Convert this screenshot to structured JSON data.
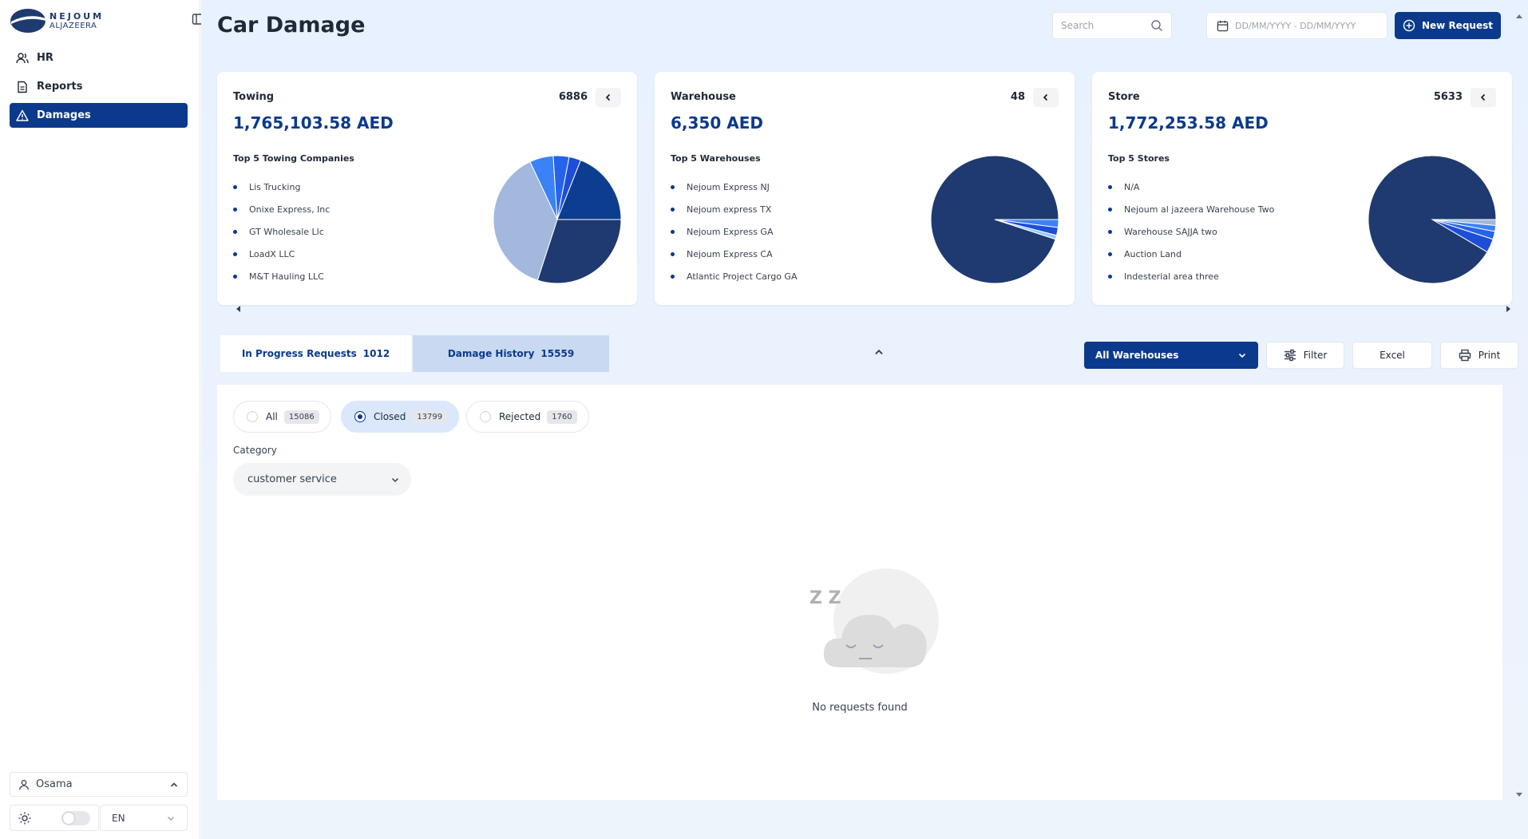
{
  "brand": {
    "line1": "NEJOUM",
    "line2": "ALJAZEERA",
    "logo_icon": "nejoum-logo-icon"
  },
  "sidebar": {
    "collapse_icon": "sidebar-toggle-icon",
    "items": [
      {
        "label": "HR",
        "icon": "users-icon",
        "active": false
      },
      {
        "label": "Reports",
        "icon": "report-icon",
        "active": false
      },
      {
        "label": "Damages",
        "icon": "warning-icon",
        "active": true
      }
    ],
    "user": {
      "name": "Osama",
      "icon": "user-icon"
    },
    "theme": {
      "icon": "sun-icon",
      "dark_mode": false
    },
    "language": {
      "value": "EN"
    }
  },
  "header": {
    "title": "Car Damage",
    "search_placeholder": "Search",
    "date_placeholder": "DD/MM/YYYY - DD/MM/YYYY",
    "new_request_label": "New Request"
  },
  "cards": [
    {
      "title": "Towing",
      "count": "6886",
      "amount": "1,765,103.58 AED",
      "subtitle": "Top 5 Towing Companies",
      "items": [
        "Lis Trucking",
        "Onixe Express, Inc",
        "GT Wholesale Llc",
        "LoadX LLC",
        "M&T Hauling LLC"
      ]
    },
    {
      "title": "Warehouse",
      "count": "48",
      "amount": "6,350 AED",
      "subtitle": "Top 5 Warehouses",
      "items": [
        "Nejoum Express NJ",
        "Nejoum express TX",
        "Nejoum Express GA",
        "Nejoum Express CA",
        "Atlantic Project Cargo GA"
      ]
    },
    {
      "title": "Store",
      "count": "5633",
      "amount": "1,772,253.58 AED",
      "subtitle": "Top 5 Stores",
      "items": [
        "N/A",
        "Nejoum al jazeera Warehouse Two",
        "Warehouse SAJJA two",
        "Auction Land",
        "Indesterial area three"
      ]
    }
  ],
  "chart_data": [
    {
      "type": "pie",
      "slices": [
        {
          "value": 30.0,
          "color": "#1e3a70"
        },
        {
          "value": 38.0,
          "color": "#a2b8dc"
        },
        {
          "value": 6.0,
          "color": "#3b82f6"
        },
        {
          "value": 4.0,
          "color": "#2563eb"
        },
        {
          "value": 3.0,
          "color": "#1d4ed8"
        },
        {
          "value": 19.0,
          "color": "#0b3d91"
        }
      ]
    },
    {
      "type": "pie",
      "slices": [
        {
          "value": 2.0,
          "color": "#3b82f6"
        },
        {
          "value": 2.0,
          "color": "#1d4ed8"
        },
        {
          "value": 1.0,
          "color": "#93c5fd"
        },
        {
          "value": 95.0,
          "color": "#1e3a70"
        }
      ]
    },
    {
      "type": "pie",
      "slices": [
        {
          "value": 1.5,
          "color": "#a2b8dc"
        },
        {
          "value": 1.5,
          "color": "#3b82f6"
        },
        {
          "value": 2.0,
          "color": "#2563eb"
        },
        {
          "value": 3.5,
          "color": "#1d4ed8"
        },
        {
          "value": 91.5,
          "color": "#1e3a70"
        }
      ]
    }
  ],
  "tabs": [
    {
      "label": "In Progress Requests",
      "count": "1012",
      "active": false
    },
    {
      "label": "Damage History",
      "count": "15559",
      "active": true
    }
  ],
  "toolbar": {
    "warehouse_select": "All Warehouses",
    "filter_label": "Filter",
    "excel_label": "Excel",
    "print_label": "Print"
  },
  "status_filters": [
    {
      "label": "All",
      "count": "15086",
      "selected": false
    },
    {
      "label": "Closed",
      "count": "13799",
      "selected": true
    },
    {
      "label": "Rejected",
      "count": "1760",
      "selected": false
    }
  ],
  "category": {
    "label": "Category",
    "value": "customer service"
  },
  "empty_state": {
    "illustration": "sleeping-cloud-icon",
    "zz": "Z Z",
    "text": "No requests found"
  },
  "colors": {
    "primary": "#0b3a8c",
    "accent_light": "#dbe7fb",
    "tab_inactive_bg": "#c9d9f2"
  }
}
